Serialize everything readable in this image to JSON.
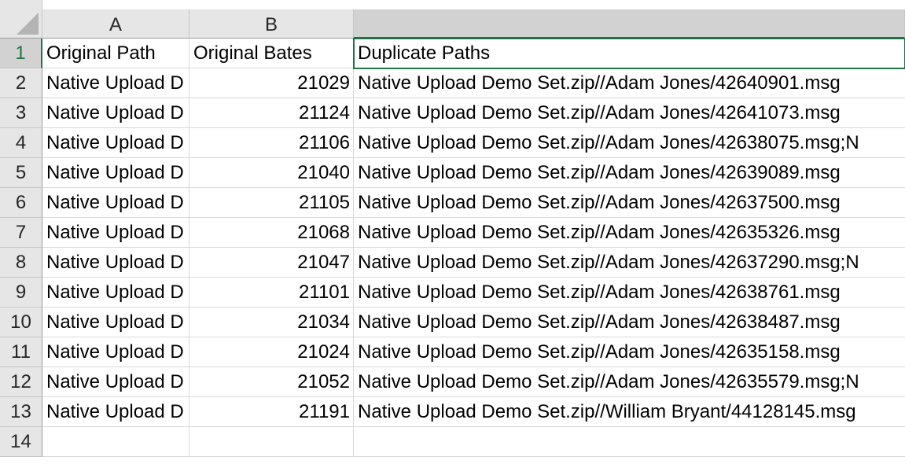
{
  "columns": [
    "A",
    "B",
    ""
  ],
  "row_numbers": [
    "1",
    "2",
    "3",
    "4",
    "5",
    "6",
    "7",
    "8",
    "9",
    "10",
    "11",
    "12",
    "13",
    "14"
  ],
  "rows": [
    {
      "a": "Original Path",
      "b": "Original Bates",
      "c": "Duplicate Paths"
    },
    {
      "a": "Native Upload D",
      "b": "21029",
      "c": "Native Upload Demo Set.zip//Adam Jones/42640901.msg"
    },
    {
      "a": "Native Upload D",
      "b": "21124",
      "c": "Native Upload Demo Set.zip//Adam Jones/42641073.msg"
    },
    {
      "a": "Native Upload D",
      "b": "21106",
      "c": "Native Upload Demo Set.zip//Adam Jones/42638075.msg;N"
    },
    {
      "a": "Native Upload D",
      "b": "21040",
      "c": "Native Upload Demo Set.zip//Adam Jones/42639089.msg"
    },
    {
      "a": "Native Upload D",
      "b": "21105",
      "c": "Native Upload Demo Set.zip//Adam Jones/42637500.msg"
    },
    {
      "a": "Native Upload D",
      "b": "21068",
      "c": "Native Upload Demo Set.zip//Adam Jones/42635326.msg"
    },
    {
      "a": "Native Upload D",
      "b": "21047",
      "c": "Native Upload Demo Set.zip//Adam Jones/42637290.msg;N"
    },
    {
      "a": "Native Upload D",
      "b": "21101",
      "c": "Native Upload Demo Set.zip//Adam Jones/42638761.msg"
    },
    {
      "a": "Native Upload D",
      "b": "21034",
      "c": "Native Upload Demo Set.zip//Adam Jones/42638487.msg"
    },
    {
      "a": "Native Upload D",
      "b": "21024",
      "c": "Native Upload Demo Set.zip//Adam Jones/42635158.msg"
    },
    {
      "a": "Native Upload D",
      "b": "21052",
      "c": "Native Upload Demo Set.zip//Adam Jones/42635579.msg;N"
    },
    {
      "a": "Native Upload D",
      "b": "21191",
      "c": "Native Upload Demo Set.zip//William Bryant/44128145.msg"
    },
    {
      "a": "",
      "b": "",
      "c": ""
    }
  ],
  "colors": {
    "accent": "#217346",
    "header_bg": "#e6e6e6",
    "gridline": "#d9d9d9"
  }
}
